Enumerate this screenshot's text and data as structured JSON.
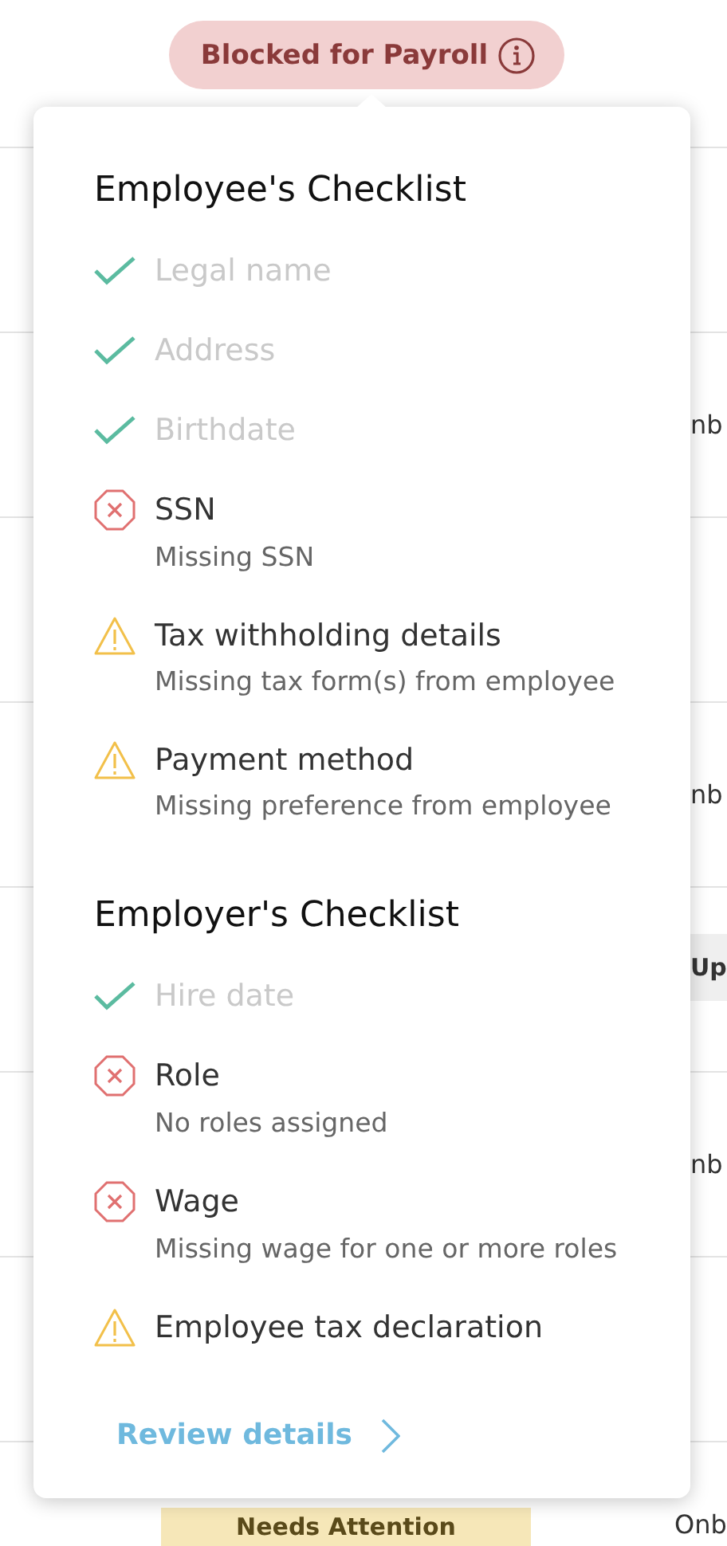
{
  "status_badge": {
    "label": "Blocked for Payroll"
  },
  "popover": {
    "sections": [
      {
        "title": "Employee's Checklist",
        "items": [
          {
            "label": "Legal name",
            "kind": "done"
          },
          {
            "label": "Address",
            "kind": "done"
          },
          {
            "label": "Birthdate",
            "kind": "done"
          },
          {
            "label": "SSN",
            "kind": "error",
            "detail": "Missing SSN"
          },
          {
            "label": "Tax withholding details",
            "kind": "warning",
            "detail": "Missing tax form(s) from employee"
          },
          {
            "label": "Payment method",
            "kind": "warning",
            "detail": "Missing preference from employee"
          }
        ]
      },
      {
        "title": "Employer's Checklist",
        "items": [
          {
            "label": "Hire date",
            "kind": "done"
          },
          {
            "label": "Role",
            "kind": "error",
            "detail": "No roles assigned"
          },
          {
            "label": "Wage",
            "kind": "error",
            "detail": "Missing wage for one or more roles"
          },
          {
            "label": "Employee tax declaration",
            "kind": "warning"
          }
        ]
      }
    ],
    "link": "Review details"
  },
  "rows": [
    {
      "kind": "blank"
    },
    {
      "kind": "text",
      "text": "nb"
    },
    {
      "kind": "blank"
    },
    {
      "kind": "text",
      "text": "nb"
    },
    {
      "kind": "button",
      "text": "Up"
    },
    {
      "kind": "text",
      "text": "nb"
    },
    {
      "kind": "blank"
    },
    {
      "kind": "badge",
      "badge": "Needs Attention",
      "text": "Onb"
    }
  ]
}
